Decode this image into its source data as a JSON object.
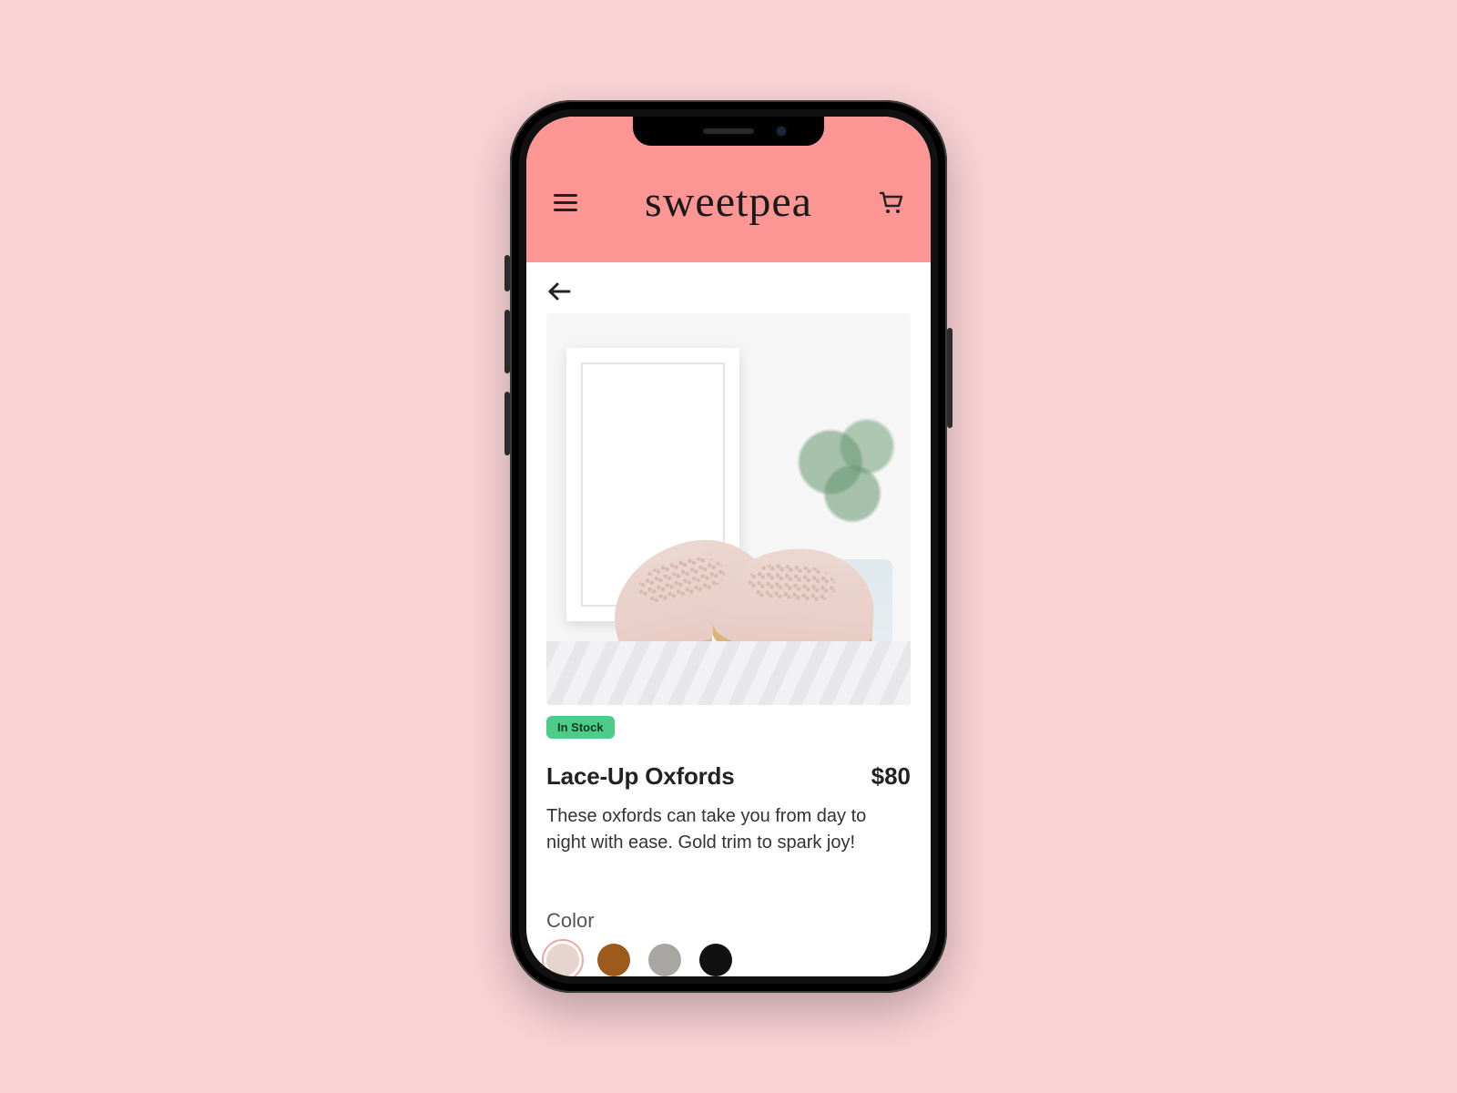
{
  "header": {
    "brand": "sweetpea"
  },
  "product": {
    "stock_label": "In Stock",
    "title": "Lace-Up Oxfords",
    "price": "$80",
    "description": "These oxfords can take you from day to night with ease. Gold trim to spark joy!",
    "color_label": "Color",
    "colors": [
      {
        "name": "blush",
        "hex": "#e6d4cf",
        "selected": true
      },
      {
        "name": "tan",
        "hex": "#9e5a1b",
        "selected": false
      },
      {
        "name": "grey",
        "hex": "#a7a6a2",
        "selected": false
      },
      {
        "name": "black",
        "hex": "#111111",
        "selected": false
      }
    ]
  }
}
